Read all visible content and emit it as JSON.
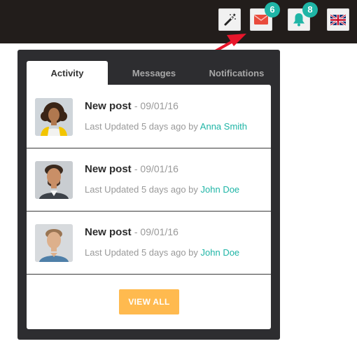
{
  "topbar": {
    "wand_icon": "magic-wand-icon",
    "mail_icon": "envelope-icon",
    "mail_badge": "6",
    "bell_icon": "bell-icon",
    "bell_badge": "8",
    "flag_icon": "uk-flag-icon",
    "colors": {
      "bar": "#221d1b",
      "badge": "#1fb5a6",
      "mail": "#e94b3c",
      "bell": "#1fb5a6",
      "arrow": "#e8162b"
    }
  },
  "tabs": [
    {
      "label": "Activity",
      "active": true
    },
    {
      "label": "Messages",
      "active": false
    },
    {
      "label": "Notifications",
      "active": false
    }
  ],
  "items": [
    {
      "title": "New post",
      "date": "- 09/01/16",
      "meta_prefix": "Last Updated 5 days ago by",
      "author": "Anna Smith"
    },
    {
      "title": "New post",
      "date": "- 09/01/16",
      "meta_prefix": "Last Updated 5 days ago by",
      "author": "John Doe"
    },
    {
      "title": "New post",
      "date": "- 09/01/16",
      "meta_prefix": "Last Updated 5 days ago by",
      "author": "John Doe"
    }
  ],
  "view_all_label": "VIEW ALL",
  "accent": "#1fb5a6",
  "button_color": "#ffba4f"
}
